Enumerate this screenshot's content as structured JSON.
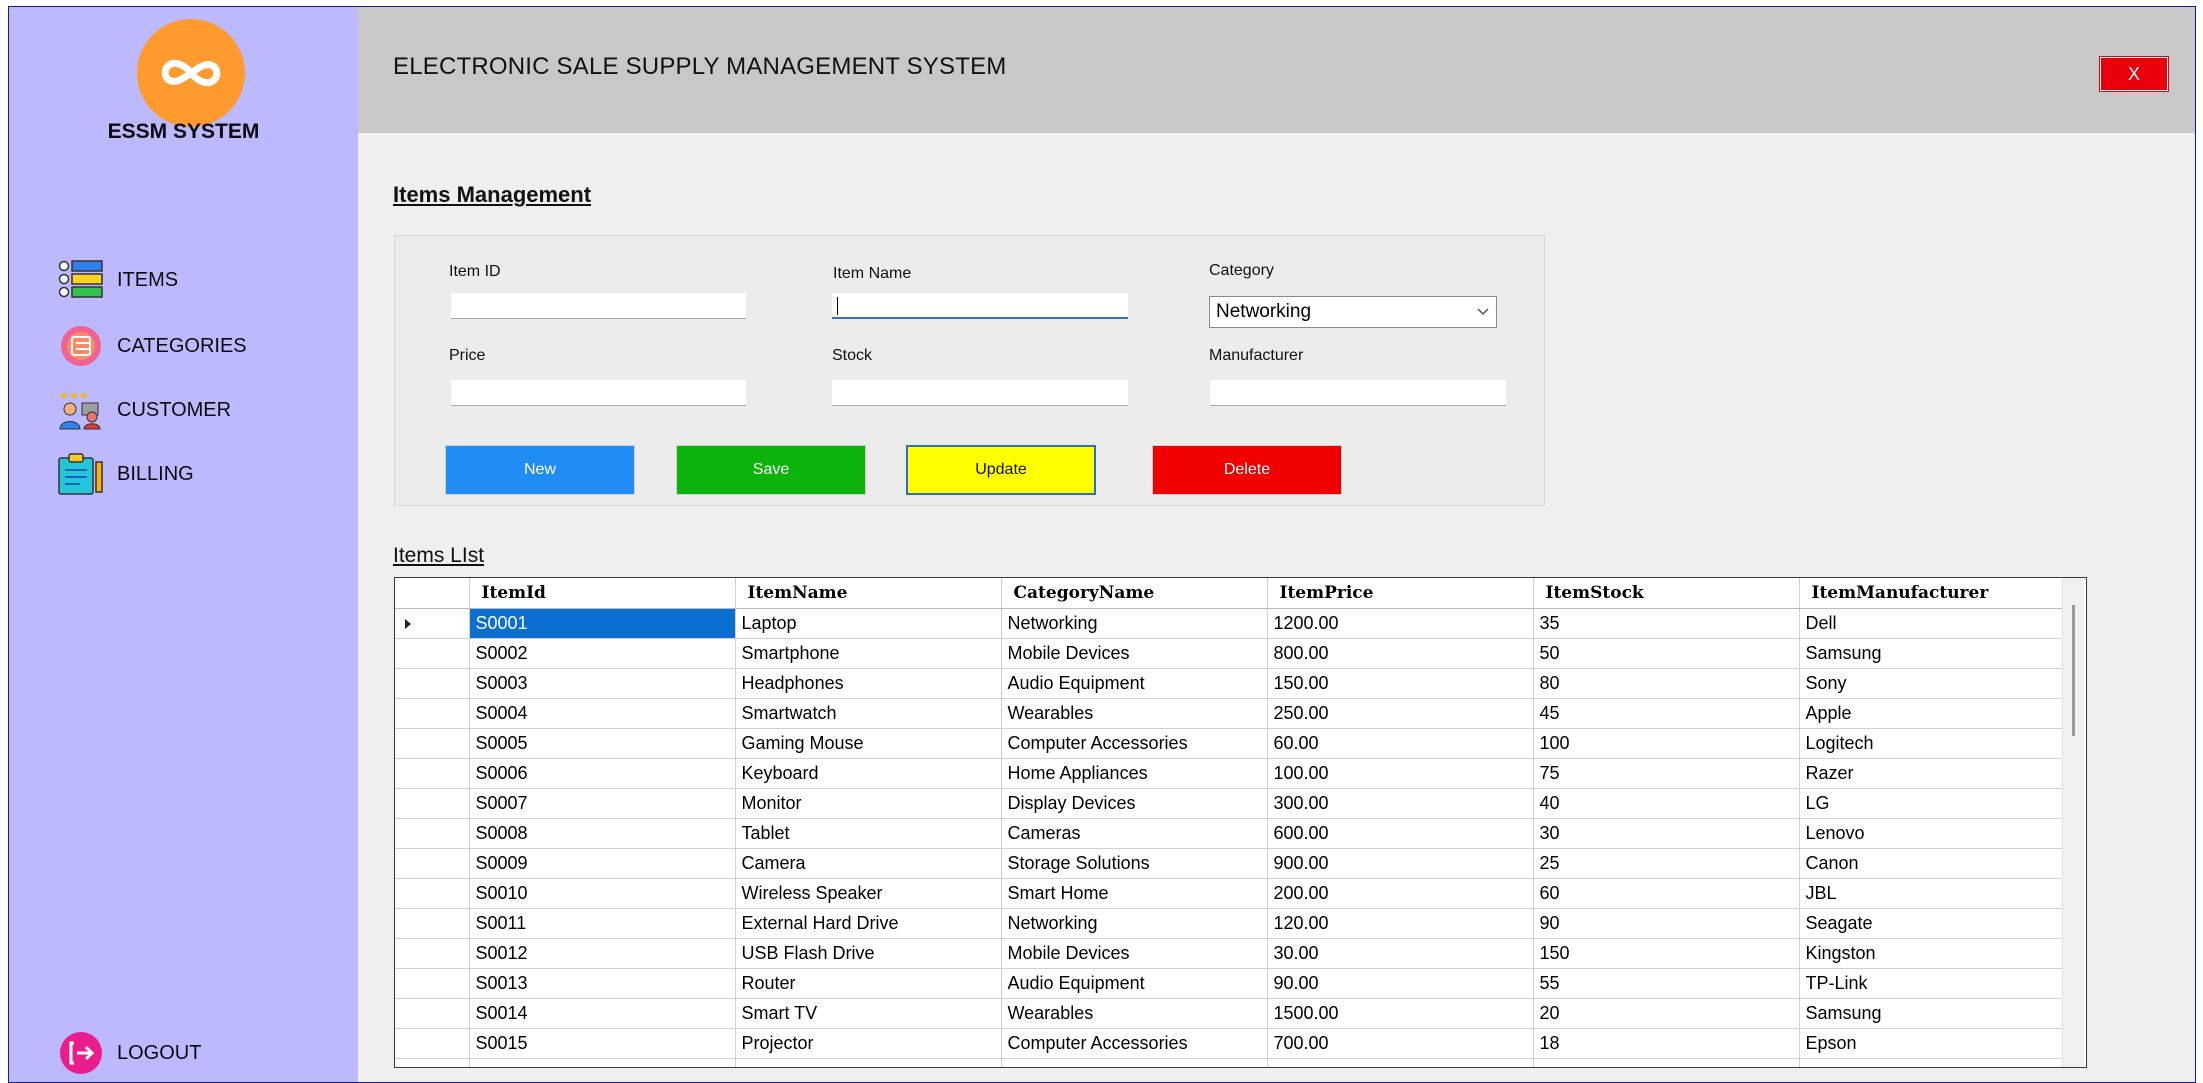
{
  "app": {
    "brand": "ESSM SYSTEM",
    "title": "ELECTRONIC SALE SUPPLY MANAGEMENT SYSTEM",
    "close_label": "X"
  },
  "sidebar": {
    "items": [
      {
        "label": "ITEMS",
        "icon": "list-icon"
      },
      {
        "label": "CATEGORIES",
        "icon": "categories-icon"
      },
      {
        "label": "CUSTOMER",
        "icon": "customers-icon"
      },
      {
        "label": "BILLING",
        "icon": "billing-icon"
      }
    ],
    "logout_label": "LOGOUT"
  },
  "form": {
    "section_title": "Items Management",
    "item_id_label": "Item ID",
    "item_id_value": "",
    "item_name_label": "Item Name",
    "item_name_value": "",
    "category_label": "Category",
    "category_value": "Networking",
    "price_label": "Price",
    "price_value": "",
    "stock_label": "Stock",
    "stock_value": "",
    "manufacturer_label": "Manufacturer",
    "manufacturer_value": ""
  },
  "buttons": {
    "new_label": "New",
    "save_label": "Save",
    "update_label": "Update",
    "delete_label": "Delete"
  },
  "colors": {
    "sidebar_bg": "#bdb9ff",
    "header_bg": "#c8c8c8",
    "new": "#1f8df5",
    "save": "#0bb30b",
    "update": "#ffff00",
    "delete": "#f00000",
    "selected_cell": "#0a6fd1",
    "close": "#e8000b"
  },
  "grid": {
    "title": "Items LIst",
    "columns": [
      "ItemId",
      "ItemName",
      "CategoryName",
      "ItemPrice",
      "ItemStock",
      "ItemManufacturer"
    ],
    "rows": [
      [
        "S0001",
        "Laptop",
        "Networking",
        "1200.00",
        "35",
        "Dell"
      ],
      [
        "S0002",
        "Smartphone",
        "Mobile Devices",
        "800.00",
        "50",
        "Samsung"
      ],
      [
        "S0003",
        "Headphones",
        "Audio Equipment",
        "150.00",
        "80",
        "Sony"
      ],
      [
        "S0004",
        "Smartwatch",
        "Wearables",
        "250.00",
        "45",
        "Apple"
      ],
      [
        "S0005",
        "Gaming Mouse",
        "Computer Accessories",
        "60.00",
        "100",
        "Logitech"
      ],
      [
        "S0006",
        "Keyboard",
        "Home Appliances",
        "100.00",
        "75",
        "Razer"
      ],
      [
        "S0007",
        "Monitor",
        "Display Devices",
        "300.00",
        "40",
        "LG"
      ],
      [
        "S0008",
        "Tablet",
        "Cameras",
        "600.00",
        "30",
        "Lenovo"
      ],
      [
        "S0009",
        "Camera",
        "Storage Solutions",
        "900.00",
        "25",
        "Canon"
      ],
      [
        "S0010",
        "Wireless Speaker",
        "Smart Home",
        "200.00",
        "60",
        "JBL"
      ],
      [
        "S0011",
        "External Hard Drive",
        "Networking",
        "120.00",
        "90",
        "Seagate"
      ],
      [
        "S0012",
        "USB Flash Drive",
        "Mobile Devices",
        "30.00",
        "150",
        "Kingston"
      ],
      [
        "S0013",
        "Router",
        "Audio Equipment",
        "90.00",
        "55",
        "TP-Link"
      ],
      [
        "S0014",
        "Smart TV",
        "Wearables",
        "1500.00",
        "20",
        "Samsung"
      ],
      [
        "S0015",
        "Projector",
        "Computer Accessories",
        "700.00",
        "18",
        "Epson"
      ],
      [
        "",
        "",
        "",
        "",
        "",
        ""
      ]
    ]
  }
}
